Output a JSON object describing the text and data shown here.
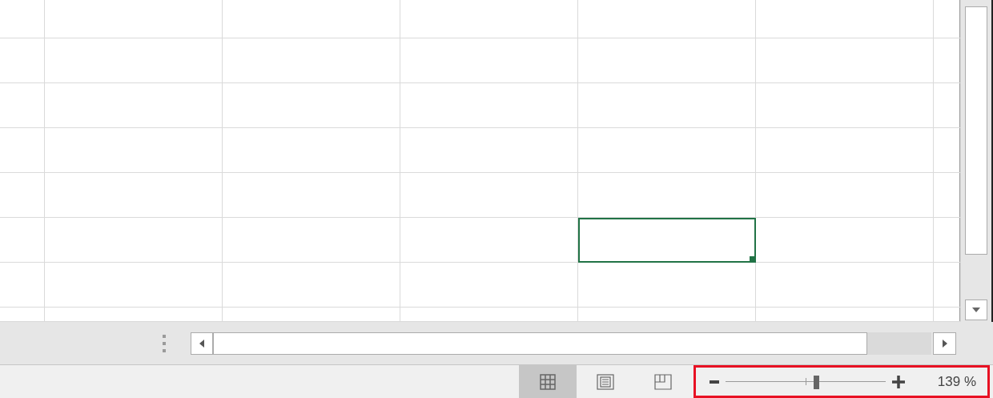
{
  "grid": {
    "rows": [
      {
        "cells": [
          {
            "selected": false
          },
          {
            "selected": false
          },
          {
            "selected": false
          },
          {
            "selected": false
          },
          {
            "selected": false
          },
          {
            "selected": false
          },
          {
            "selected": false
          }
        ]
      },
      {
        "cells": [
          {
            "selected": false
          },
          {
            "selected": false
          },
          {
            "selected": false
          },
          {
            "selected": false
          },
          {
            "selected": false
          },
          {
            "selected": false
          },
          {
            "selected": false
          }
        ]
      },
      {
        "cells": [
          {
            "selected": false
          },
          {
            "selected": false
          },
          {
            "selected": false
          },
          {
            "selected": false
          },
          {
            "selected": false
          },
          {
            "selected": false
          },
          {
            "selected": false
          }
        ]
      },
      {
        "cells": [
          {
            "selected": false
          },
          {
            "selected": false
          },
          {
            "selected": false
          },
          {
            "selected": false
          },
          {
            "selected": false
          },
          {
            "selected": false
          },
          {
            "selected": false
          }
        ]
      },
      {
        "cells": [
          {
            "selected": false
          },
          {
            "selected": false
          },
          {
            "selected": false
          },
          {
            "selected": false
          },
          {
            "selected": false
          },
          {
            "selected": false
          },
          {
            "selected": false
          }
        ]
      },
      {
        "cells": [
          {
            "selected": false
          },
          {
            "selected": false
          },
          {
            "selected": false
          },
          {
            "selected": false
          },
          {
            "selected": true
          },
          {
            "selected": false
          },
          {
            "selected": false
          }
        ]
      },
      {
        "cells": [
          {
            "selected": false
          },
          {
            "selected": false
          },
          {
            "selected": false
          },
          {
            "selected": false
          },
          {
            "selected": false
          },
          {
            "selected": false
          },
          {
            "selected": false
          }
        ]
      },
      {
        "cells": [
          {
            "selected": false
          },
          {
            "selected": false
          },
          {
            "selected": false
          },
          {
            "selected": false
          },
          {
            "selected": false
          },
          {
            "selected": false
          },
          {
            "selected": false
          }
        ]
      }
    ]
  },
  "status_bar": {
    "view_buttons": [
      {
        "kind": "normal",
        "selected": true
      },
      {
        "kind": "page-layout",
        "selected": false
      },
      {
        "kind": "page-break",
        "selected": false
      }
    ],
    "zoom": {
      "level": 0.565,
      "label": "139 %",
      "highlighted": true
    }
  }
}
